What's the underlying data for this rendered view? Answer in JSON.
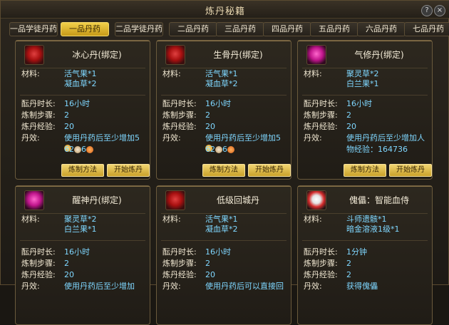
{
  "window": {
    "title": "炼丹秘籍",
    "help_icon": "question-mark-icon",
    "close_icon": "close-icon"
  },
  "tabs": [
    {
      "label": "一品学徒丹药",
      "active": false
    },
    {
      "label": "一品丹药",
      "active": true
    },
    {
      "label": "二品学徒丹药",
      "active": false
    },
    {
      "label": "二品丹药",
      "active": false
    },
    {
      "label": "三品丹药",
      "active": false
    },
    {
      "label": "四品丹药",
      "active": false
    },
    {
      "label": "五品丹药",
      "active": false
    },
    {
      "label": "六品丹药",
      "active": false
    },
    {
      "label": "七品丹药",
      "active": false
    }
  ],
  "labels": {
    "material": "材料:",
    "time": "酝丹时长:",
    "steps": "炼制步骤:",
    "exp": "炼丹经验:",
    "effect": "丹效:",
    "craft_button": "炼制方法",
    "start_button": "开始炼丹"
  },
  "cards": [
    {
      "name": "冰心丹(绑定)",
      "materials": [
        "活气果*1",
        "凝血草*2"
      ],
      "time": "16小时",
      "steps": "2",
      "exp": "20",
      "effect_line1": "使用丹药后至少增加5",
      "effect_line2a": "62",
      "effect_line2b": "6"
    },
    {
      "name": "生骨丹(绑定)",
      "materials": [
        "活气果*1",
        "凝血草*2"
      ],
      "time": "16小时",
      "steps": "2",
      "exp": "20",
      "effect_line1": "使用丹药后至少增加5",
      "effect_line2a": "62",
      "effect_line2b": "6"
    },
    {
      "name": "气修丹(绑定)",
      "materials": [
        "聚灵草*2",
        "白兰果*1"
      ],
      "time": "16小时",
      "steps": "2",
      "exp": "20",
      "effect_line1": "使用丹药后至少增加人",
      "effect_line2": "物经验：164736"
    },
    {
      "name": "醒神丹(绑定)",
      "materials": [
        "聚灵草*2",
        "白兰果*1"
      ],
      "time": "16小时",
      "steps": "2",
      "exp": "20",
      "effect_line1": "使用丹药后至少增加"
    },
    {
      "name": "低级回城丹",
      "materials": [
        "活气果*1",
        "凝血草*2"
      ],
      "time": "16小时",
      "steps": "2",
      "exp": "20",
      "effect_line1": "使用丹药后可以直接回"
    },
    {
      "name": "傀儡：智能血侍",
      "materials": [
        "斗师遗骸*1",
        "暗金溶液1级*1"
      ],
      "time": "1分钟",
      "steps": "2",
      "exp": "2",
      "effect_line1": "获得傀儡"
    }
  ]
}
